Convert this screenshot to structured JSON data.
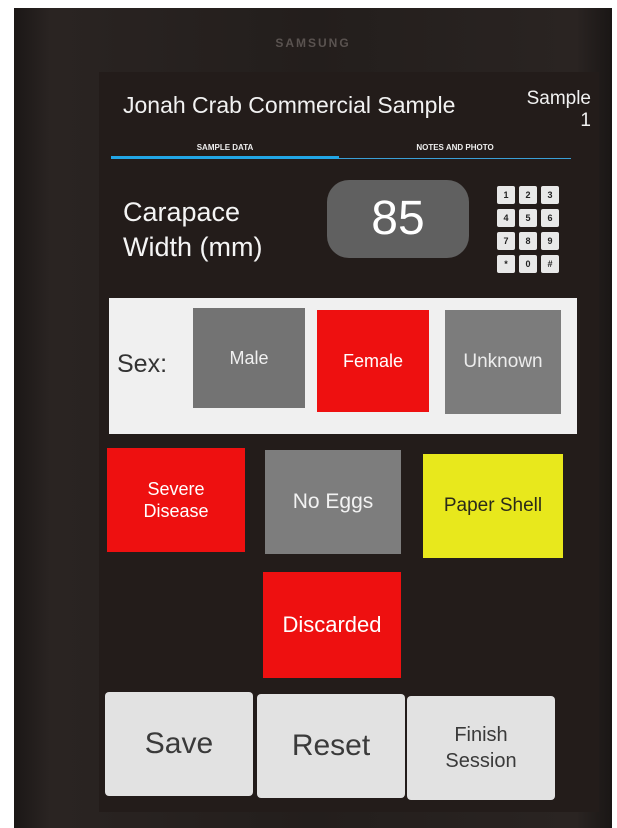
{
  "device": {
    "brand": "SAMSUNG"
  },
  "header": {
    "title": "Jonah Crab Commercial Sample",
    "sample_label": "Sample",
    "sample_number": "1"
  },
  "tabs": [
    {
      "label": "SAMPLE DATA",
      "active": true
    },
    {
      "label": "NOTES AND PHOTO",
      "active": false
    }
  ],
  "carapace": {
    "label_line1": "Carapace",
    "label_line2": "Width (mm)",
    "value": "85",
    "keypad_keys": [
      "1",
      "2",
      "3",
      "4",
      "5",
      "6",
      "7",
      "8",
      "9",
      "*",
      "0",
      "#"
    ]
  },
  "sex": {
    "label": "Sex:",
    "options": [
      {
        "label": "Male",
        "selected": false
      },
      {
        "label": "Female",
        "selected": true
      },
      {
        "label": "Unknown",
        "selected": false
      }
    ]
  },
  "flags": {
    "severe_disease_line1": "Severe",
    "severe_disease_line2": "Disease",
    "no_eggs": "No Eggs",
    "paper_shell": "Paper Shell",
    "discarded": "Discarded"
  },
  "actions": {
    "save": "Save",
    "reset": "Reset",
    "finish_line1": "Finish",
    "finish_line2": "Session"
  },
  "colors": {
    "selected_red": "#ee1010",
    "unselected_gray": "#7a7a7a",
    "paper_shell_yellow": "#e8e81c",
    "tab_indicator": "#22a6e6",
    "screen_background": "#231c1a"
  }
}
